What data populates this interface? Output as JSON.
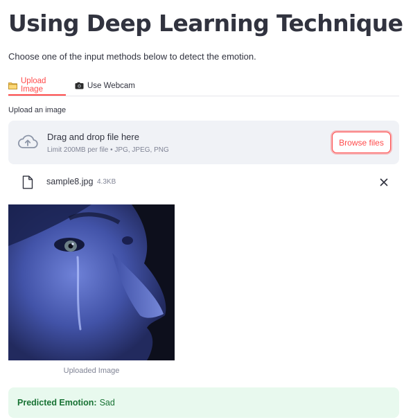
{
  "header": {
    "title": "Using Deep Learning Techniques",
    "subtitle": "Choose one of the input methods below to detect the emotion."
  },
  "tabs": [
    {
      "label": "Upload Image",
      "icon": "folder-icon",
      "active": true
    },
    {
      "label": "Use Webcam",
      "icon": "camera-icon",
      "active": false
    }
  ],
  "uploader": {
    "label": "Upload an image",
    "drop_title": "Drag and drop file here",
    "drop_limits": "Limit 200MB per file • JPG, JPEG, PNG",
    "browse_label": "Browse files",
    "icon": "cloud-upload-icon"
  },
  "file": {
    "name": "sample8.jpg",
    "size": "4.3KB",
    "icon": "file-icon",
    "remove_icon": "close-icon"
  },
  "image": {
    "caption": "Uploaded Image"
  },
  "result": {
    "label": "Predicted Emotion:",
    "value": "Sad"
  },
  "colors": {
    "accent": "#ff4b4b",
    "text": "#31333f",
    "muted": "#808495",
    "dropzone_bg": "#f0f2f6",
    "success_bg": "#e8f9ee",
    "success_text": "#177233"
  }
}
